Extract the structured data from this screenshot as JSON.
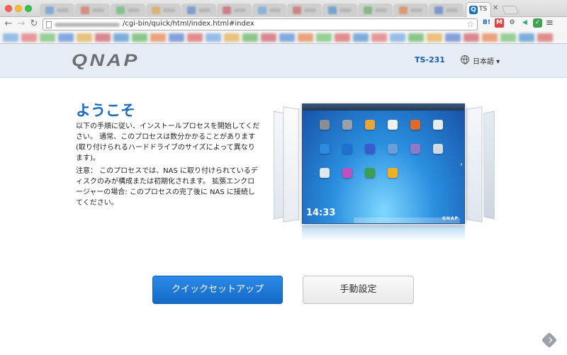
{
  "browser": {
    "active_tab_title": "TS",
    "url": "/cgi-bin/quick/html/index.html#index",
    "extensions": [
      "B!",
      "M",
      "⚙",
      "◀",
      "✓"
    ]
  },
  "header": {
    "logo": "QNAP",
    "model": "TS-231",
    "language": "日本語 ▾"
  },
  "welcome": {
    "title": "ようこそ",
    "paragraph1": "以下の手順に従い、インストールプロセスを開始してください。 通常、このプロセスは数分かかることがあります (取り付けられるハードドライブのサイズによって異なります)。",
    "paragraph2": "注意： このプロセスでは、NAS に取り付けられているディスクのみが構成または初期化されます。 拡張エンクロージャーの場合: このプロセスの完了後に NAS に接続してください。"
  },
  "hero": {
    "clock": "14:33",
    "screen_logo": "QNAP"
  },
  "buttons": {
    "quick_setup": "クイックセットアップ",
    "manual_setup": "手動設定"
  },
  "colors": {
    "accent": "#1b6bc3",
    "primary_button": "#1a79d8",
    "header_bg": "#e6ecf3"
  }
}
